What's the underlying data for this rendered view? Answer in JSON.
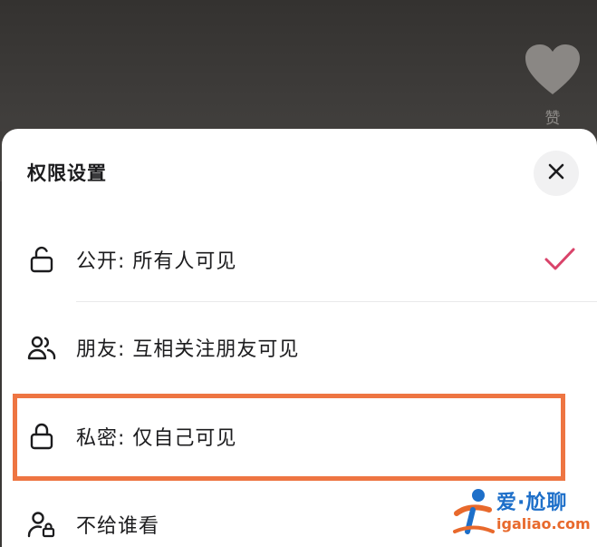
{
  "video": {
    "like_label": "赞"
  },
  "sheet": {
    "title": "权限设置",
    "close_icon": "close-icon",
    "options": [
      {
        "icon": "unlock-icon",
        "label": "公开: 所有人可见",
        "selected": true
      },
      {
        "icon": "friends-icon",
        "label": "朋友: 互相关注朋友可见",
        "selected": false
      },
      {
        "icon": "lock-icon",
        "label": "私密: 仅自己可见",
        "selected": false,
        "highlighted": true
      },
      {
        "icon": "person-lock-icon",
        "label": "不给谁看",
        "selected": false
      }
    ]
  },
  "colors": {
    "check": "#d9436a",
    "highlight": "#ee7542",
    "watermark_blue": "#1d6fc9",
    "watermark_orange": "#e8692c"
  },
  "watermark": {
    "brand": "爱·尬聊",
    "url": "igaliao.com"
  }
}
